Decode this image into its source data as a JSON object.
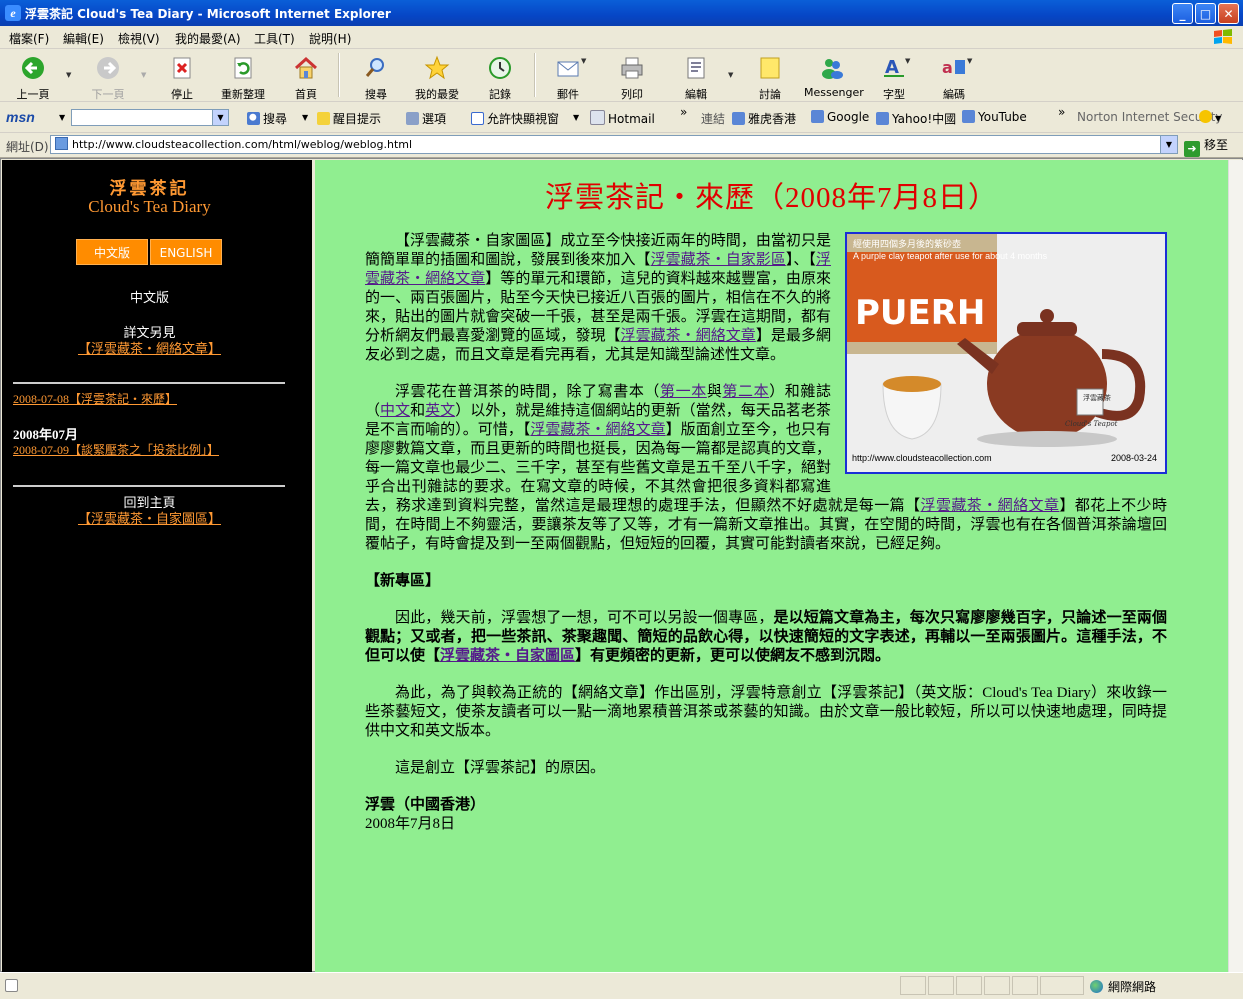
{
  "window": {
    "title": "浮雲茶記 Cloud's Tea Diary - Microsoft Internet Explorer",
    "min_label": "_",
    "max_label": "□",
    "close_label": "✕"
  },
  "menu": [
    "檔案(F)",
    "編輯(E)",
    "檢視(V)",
    "我的最愛(A)",
    "工具(T)",
    "說明(H)"
  ],
  "toolbar": {
    "back": "上一頁",
    "forward": "下一頁",
    "stop": "停止",
    "refresh": "重新整理",
    "home": "首頁",
    "search": "搜尋",
    "favorites": "我的最愛",
    "history": "記錄",
    "mail": "郵件",
    "print": "列印",
    "edit": "編輯",
    "discuss": "討論",
    "messenger": "Messenger",
    "font": "字型",
    "encoding": "編碼"
  },
  "msnbar": {
    "logo": "msn",
    "search": "搜尋",
    "highlight": "醒目提示",
    "options": "選項",
    "popup": "允許快顯視窗",
    "hotmail": "Hotmail",
    "links_label": "連結",
    "links": [
      "雅虎香港",
      "Google",
      "Yahoo!中國",
      "YouTube"
    ],
    "norton": "Norton Internet Security"
  },
  "address": {
    "label": "網址(D)",
    "url": "http://www.cloudsteacollection.com/html/weblog/weblog.html",
    "go": "移至"
  },
  "sidebar": {
    "title_zh": "浮雲茶記",
    "title_en": "Cloud's Tea Diary",
    "btn_zh": "中文版",
    "btn_en": "ENGLISH",
    "version": "中文版",
    "more_label": "詳文另見",
    "more_link": "【浮雲藏茶・網絡文章】",
    "recent_link": "2008-07-08【浮雲茶記・來歷】",
    "month": "2008年07月",
    "month_link": "2008-07-09【談緊壓茶之「投茶比例」】",
    "home_label": "回到主頁",
    "home_link": "【浮雲藏茶・自家圖區】"
  },
  "article": {
    "heading": "浮雲茶記・來歷（2008年7月8日）",
    "figure_caption_zh": "經使用四個多月後的紫砂壺",
    "figure_caption_en": "A purple clay teapot after use for about 4 months",
    "figure_url": "http://www.cloudsteacollection.com",
    "figure_date": "2008-03-24",
    "figure_brand": "PUERH",
    "figure_seal": "浮雲藏茶",
    "figure_teapot": "Cloud's Teapot",
    "p1_a": "【浮雲藏茶・自家圖區】成立至今快接近兩年的時間，由當初只是簡簡單單的插圖和圖說，發展到後來加入【",
    "p1_link1": "浮雲藏茶・自家影區",
    "p1_b": "】、【",
    "p1_link2": "浮雲藏茶・網絡文章",
    "p1_c": "】等的單元和環節，這兒的資料越來越豐富，由原來的一、兩百張圖片，貼至今天快已接近八百張的圖片，相信在不久的將來，貼出的圖片就會突破一千張，甚至是兩千張。浮雲在這期間，都有分析網友們最喜愛瀏覽的區域，發現【",
    "p1_link3": "浮雲藏茶・網絡文章",
    "p1_d": "】是最多網友必到之處，而且文章是看完再看，尤其是知識型論述性文章。",
    "p2_a": "浮雲花在普洱茶的時間，除了寫書本（",
    "p2_link1": "第一本",
    "p2_b": "與",
    "p2_link2": "第二本",
    "p2_c": "）和雜誌（",
    "p2_link3": "中文",
    "p2_d": "和",
    "p2_link4": "英文",
    "p2_e": "）以外，就是維持這個網站的更新（當然，每天品茗老茶是不言而喻的）。可惜，【",
    "p2_link5": "浮雲藏茶・網絡文章",
    "p2_f": "】版面創立至今，也只有廖廖數篇文章，而且更新的時間也挺長，因為每一篇都是認真的文章，每一篇文章也最少二、三千字，甚至有些舊文章是五千至八千字，絕對乎合出刊雜誌的要求。在寫文章的時候，不其然會把很多資料都寫進去，務求達到資料完整，當然這是最理想的處理手法，但顯然不好處就是每一篇【",
    "p2_link6": "浮雲藏茶・網絡文章",
    "p2_g": "】都花上不少時間，在時間上不夠靈活，要讓茶友等了又等，才有一篇新文章推出。其實，在空閒的時間，浮雲也有在各個普洱茶論壇回覆帖子，有時會提及到一至兩個觀點，但短短的回覆，其實可能對讀者來說，已經足夠。",
    "section": "【新專區】",
    "p3_a": "因此，幾天前，浮雲想了一想，可不可以另設一個專區，",
    "p3_b": "是以短篇文章為主，每次只寫廖廖幾百字，只論述一至兩個觀點；又或者，把一些茶訊、茶聚趣聞、簡短的品飲心得，以快速簡短的文字表述，再輔以一至兩張圖片。這種手法，不但可以使【",
    "p3_link": "浮雲藏茶・自家圖區",
    "p3_c": "】有更頻密的更新，更可以使網友不感到沉悶。",
    "p4": "為此，為了與較為正統的【網絡文章】作出區別，浮雲特意創立【浮雲茶記】（英文版：Cloud's Tea Diary）來收錄一些茶藝短文，使茶友讀者可以一點一滴地累積普洱茶或茶藝的知識。由於文章一般比較短，所以可以快速地處理，同時提供中文和英文版本。",
    "p5": "這是創立【浮雲茶記】的原因。",
    "sign": "浮雲（中國香港）",
    "date": "2008年7月8日"
  },
  "status": {
    "zone": "網際網路"
  }
}
